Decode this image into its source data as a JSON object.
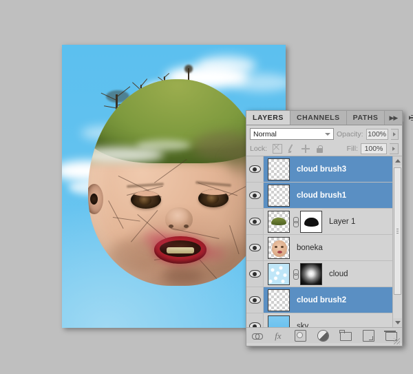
{
  "app": {
    "panel_title": "LAYERS"
  },
  "panel": {
    "tabs": [
      {
        "label": "LAYERS",
        "active": true
      },
      {
        "label": "CHANNELS",
        "active": false
      },
      {
        "label": "PATHS",
        "active": false
      }
    ],
    "collapse_icon": "double-chevron-right-icon",
    "menu_icon": "panel-menu-icon",
    "blend": {
      "mode": "Normal",
      "opacity_label": "Opacity:",
      "opacity_value": "100%"
    },
    "lock": {
      "label": "Lock:",
      "icons": [
        "lock-transparent-pixels-icon",
        "lock-image-pixels-icon",
        "lock-position-icon",
        "lock-all-icon"
      ],
      "fill_label": "Fill:",
      "fill_value": "100%"
    },
    "layers": [
      {
        "name": "cloud brush3",
        "selected": true,
        "visible": true,
        "thumb": "transparent-checker",
        "has_mask": false,
        "linked": false
      },
      {
        "name": "cloud brush1",
        "selected": true,
        "visible": true,
        "thumb": "transparent-checker",
        "has_mask": false,
        "linked": false
      },
      {
        "name": "Layer 1",
        "selected": false,
        "visible": true,
        "thumb": "moss-streak",
        "has_mask": true,
        "mask": "black-blob-on-white",
        "linked": true
      },
      {
        "name": "boneka",
        "selected": false,
        "visible": true,
        "thumb": "doll-face",
        "has_mask": false,
        "linked": false
      },
      {
        "name": "cloud",
        "selected": false,
        "visible": true,
        "thumb": "cloud-texture",
        "has_mask": true,
        "mask": "radial-white-on-black",
        "linked": true
      },
      {
        "name": "cloud brush2",
        "selected": true,
        "visible": true,
        "thumb": "transparent-checker",
        "has_mask": false,
        "linked": false
      },
      {
        "name": "sky",
        "selected": false,
        "visible": true,
        "thumb": "sky-blue",
        "has_mask": false,
        "linked": false
      }
    ],
    "footer_tools": [
      "link-layers-icon",
      "layer-styles-fx-icon",
      "add-layer-mask-icon",
      "new-adjustment-layer-icon",
      "new-group-folder-icon",
      "new-layer-icon",
      "delete-layer-trash-icon"
    ],
    "scrollbar": {
      "up_icon": "scroll-up-arrow-icon",
      "down_icon": "scroll-down-arrow-icon"
    },
    "resize_grip": "resize-grip-icon"
  },
  "colors": {
    "selection_blue": "#5a8fc3",
    "panel_gray": "#d3d3d3",
    "tab_gray": "#b2b2b2",
    "desktop_gray": "#bfbfbf",
    "sky_blue": "#5cc0ef",
    "moss_green": "#7e9a3e",
    "lip_red": "#c9303a",
    "skin": "#e3b596"
  },
  "canvas": {
    "description": "surreal photo composite of a cracked antique doll head whose scalp is a grassy planet with bare trees, against a blue sky with white clouds"
  }
}
